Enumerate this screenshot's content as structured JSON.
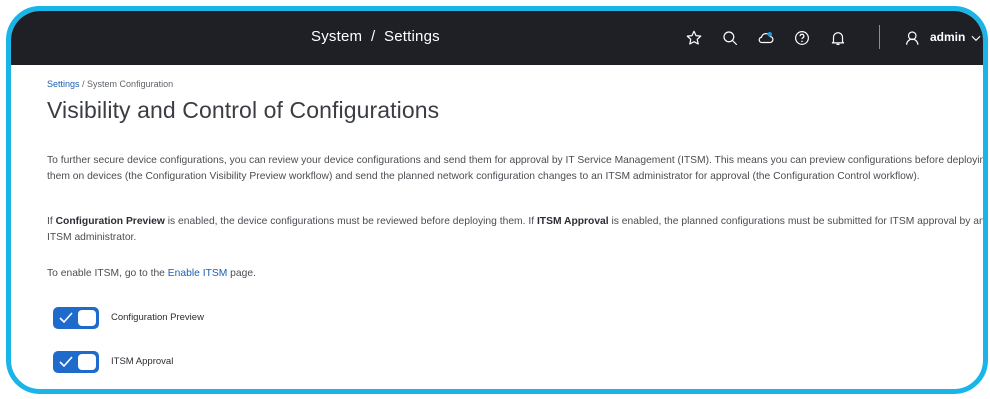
{
  "header": {
    "title": "System  /  Settings",
    "user_name": "admin",
    "icons": [
      "star-icon",
      "search-icon",
      "cloud-icon",
      "help-icon",
      "bell-icon",
      "user-icon",
      "chevron-down-icon"
    ]
  },
  "breadcrumb": {
    "root": "Settings",
    "separator": " / ",
    "current": "System Configuration"
  },
  "page": {
    "title": "Visibility and Control of Configurations",
    "intro": "To further secure device configurations, you can review your device configurations and send them for approval by IT Service Management (ITSM). This means you can preview configurations before deploying them on devices (the Configuration Visibility Preview workflow) and send the planned network configuration changes to an ITSM administrator for approval (the Configuration Control workflow).",
    "p2_a": "If ",
    "p2_b1": "Configuration Preview",
    "p2_c": " is enabled, the device configurations must be reviewed before deploying them. If ",
    "p2_b2": "ITSM Approval",
    "p2_d": " is enabled, the planned configurations must be submitted for ITSM approval by an ITSM administrator.",
    "p3_a": "To enable ITSM, go to the ",
    "p3_link": "Enable ITSM",
    "p3_b": " page."
  },
  "toggles": [
    {
      "label": "Configuration Preview",
      "enabled": true
    },
    {
      "label": "ITSM Approval",
      "enabled": true
    }
  ],
  "colors": {
    "frame": "#19b4e8",
    "header_bg": "#1e2025",
    "toggle_on": "#1f6bcc",
    "link": "#1a5fb4"
  }
}
